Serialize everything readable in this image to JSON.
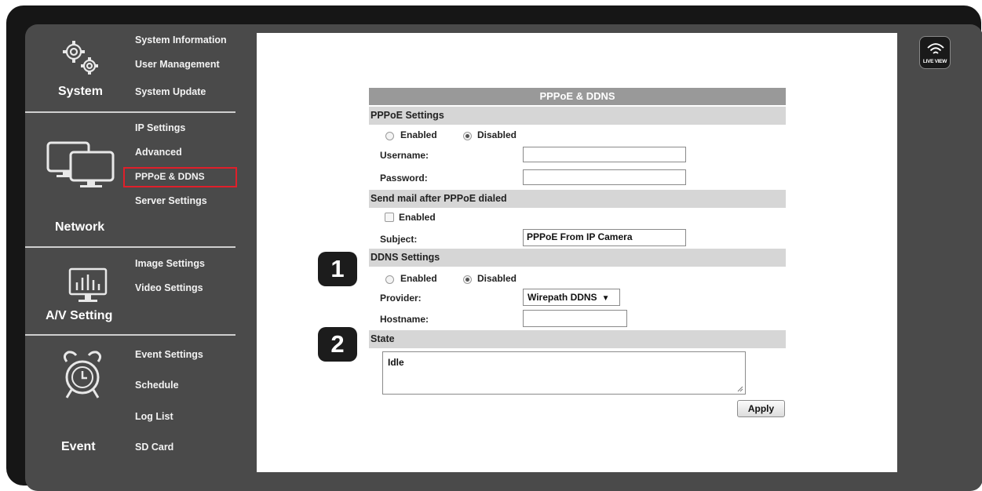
{
  "sidebar": {
    "system": {
      "title": "System",
      "items": [
        "System Information",
        "User Management",
        "System Update"
      ]
    },
    "network": {
      "title": "Network",
      "items": [
        "IP Settings",
        "Advanced",
        "PPPoE & DDNS",
        "Server Settings"
      ]
    },
    "av": {
      "title": "A/V Setting",
      "items": [
        "Image Settings",
        "Video Settings"
      ]
    },
    "event": {
      "title": "Event",
      "items": [
        "Event Settings",
        "Schedule",
        "Log List",
        "SD Card"
      ]
    }
  },
  "live_view": {
    "label": "LIVE VIEW"
  },
  "form": {
    "title": "PPPoE & DDNS",
    "pppoe": {
      "section": "PPPoE Settings",
      "enabled_label": "Enabled",
      "disabled_label": "Disabled",
      "selected": "Disabled",
      "username_label": "Username:",
      "username_value": "",
      "password_label": "Password:",
      "password_value": ""
    },
    "mail": {
      "section": "Send mail after PPPoE dialed",
      "enabled_label": "Enabled",
      "enabled_checked": false,
      "subject_label": "Subject:",
      "subject_value": "PPPoE From IP Camera"
    },
    "ddns": {
      "section": "DDNS Settings",
      "enabled_label": "Enabled",
      "disabled_label": "Disabled",
      "selected": "Disabled",
      "provider_label": "Provider:",
      "provider_value": "Wirepath DDNS",
      "hostname_label": "Hostname:",
      "hostname_value": ""
    },
    "state": {
      "section": "State",
      "value": "Idle"
    },
    "apply_label": "Apply"
  },
  "callouts": [
    "1",
    "2"
  ],
  "colors": {
    "highlight": "#e01f2a",
    "panel_header": "#999999",
    "section_bar": "#d6d6d6",
    "frame": "#4a4a4a"
  }
}
